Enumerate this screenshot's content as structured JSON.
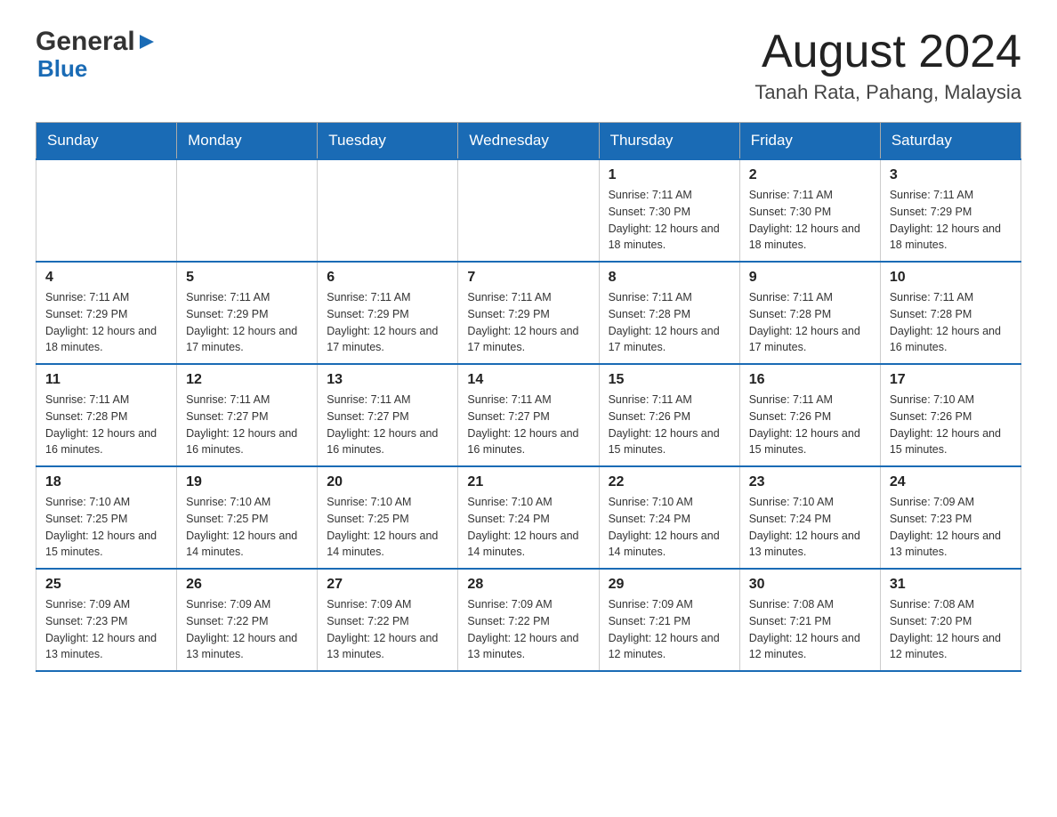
{
  "logo": {
    "general": "General",
    "blue": "Blue"
  },
  "header": {
    "title": "August 2024",
    "subtitle": "Tanah Rata, Pahang, Malaysia"
  },
  "weekdays": [
    "Sunday",
    "Monday",
    "Tuesday",
    "Wednesday",
    "Thursday",
    "Friday",
    "Saturday"
  ],
  "weeks": [
    [
      {
        "day": "",
        "info": ""
      },
      {
        "day": "",
        "info": ""
      },
      {
        "day": "",
        "info": ""
      },
      {
        "day": "",
        "info": ""
      },
      {
        "day": "1",
        "sunrise": "Sunrise: 7:11 AM",
        "sunset": "Sunset: 7:30 PM",
        "daylight": "Daylight: 12 hours and 18 minutes."
      },
      {
        "day": "2",
        "sunrise": "Sunrise: 7:11 AM",
        "sunset": "Sunset: 7:30 PM",
        "daylight": "Daylight: 12 hours and 18 minutes."
      },
      {
        "day": "3",
        "sunrise": "Sunrise: 7:11 AM",
        "sunset": "Sunset: 7:29 PM",
        "daylight": "Daylight: 12 hours and 18 minutes."
      }
    ],
    [
      {
        "day": "4",
        "sunrise": "Sunrise: 7:11 AM",
        "sunset": "Sunset: 7:29 PM",
        "daylight": "Daylight: 12 hours and 18 minutes."
      },
      {
        "day": "5",
        "sunrise": "Sunrise: 7:11 AM",
        "sunset": "Sunset: 7:29 PM",
        "daylight": "Daylight: 12 hours and 17 minutes."
      },
      {
        "day": "6",
        "sunrise": "Sunrise: 7:11 AM",
        "sunset": "Sunset: 7:29 PM",
        "daylight": "Daylight: 12 hours and 17 minutes."
      },
      {
        "day": "7",
        "sunrise": "Sunrise: 7:11 AM",
        "sunset": "Sunset: 7:29 PM",
        "daylight": "Daylight: 12 hours and 17 minutes."
      },
      {
        "day": "8",
        "sunrise": "Sunrise: 7:11 AM",
        "sunset": "Sunset: 7:28 PM",
        "daylight": "Daylight: 12 hours and 17 minutes."
      },
      {
        "day": "9",
        "sunrise": "Sunrise: 7:11 AM",
        "sunset": "Sunset: 7:28 PM",
        "daylight": "Daylight: 12 hours and 17 minutes."
      },
      {
        "day": "10",
        "sunrise": "Sunrise: 7:11 AM",
        "sunset": "Sunset: 7:28 PM",
        "daylight": "Daylight: 12 hours and 16 minutes."
      }
    ],
    [
      {
        "day": "11",
        "sunrise": "Sunrise: 7:11 AM",
        "sunset": "Sunset: 7:28 PM",
        "daylight": "Daylight: 12 hours and 16 minutes."
      },
      {
        "day": "12",
        "sunrise": "Sunrise: 7:11 AM",
        "sunset": "Sunset: 7:27 PM",
        "daylight": "Daylight: 12 hours and 16 minutes."
      },
      {
        "day": "13",
        "sunrise": "Sunrise: 7:11 AM",
        "sunset": "Sunset: 7:27 PM",
        "daylight": "Daylight: 12 hours and 16 minutes."
      },
      {
        "day": "14",
        "sunrise": "Sunrise: 7:11 AM",
        "sunset": "Sunset: 7:27 PM",
        "daylight": "Daylight: 12 hours and 16 minutes."
      },
      {
        "day": "15",
        "sunrise": "Sunrise: 7:11 AM",
        "sunset": "Sunset: 7:26 PM",
        "daylight": "Daylight: 12 hours and 15 minutes."
      },
      {
        "day": "16",
        "sunrise": "Sunrise: 7:11 AM",
        "sunset": "Sunset: 7:26 PM",
        "daylight": "Daylight: 12 hours and 15 minutes."
      },
      {
        "day": "17",
        "sunrise": "Sunrise: 7:10 AM",
        "sunset": "Sunset: 7:26 PM",
        "daylight": "Daylight: 12 hours and 15 minutes."
      }
    ],
    [
      {
        "day": "18",
        "sunrise": "Sunrise: 7:10 AM",
        "sunset": "Sunset: 7:25 PM",
        "daylight": "Daylight: 12 hours and 15 minutes."
      },
      {
        "day": "19",
        "sunrise": "Sunrise: 7:10 AM",
        "sunset": "Sunset: 7:25 PM",
        "daylight": "Daylight: 12 hours and 14 minutes."
      },
      {
        "day": "20",
        "sunrise": "Sunrise: 7:10 AM",
        "sunset": "Sunset: 7:25 PM",
        "daylight": "Daylight: 12 hours and 14 minutes."
      },
      {
        "day": "21",
        "sunrise": "Sunrise: 7:10 AM",
        "sunset": "Sunset: 7:24 PM",
        "daylight": "Daylight: 12 hours and 14 minutes."
      },
      {
        "day": "22",
        "sunrise": "Sunrise: 7:10 AM",
        "sunset": "Sunset: 7:24 PM",
        "daylight": "Daylight: 12 hours and 14 minutes."
      },
      {
        "day": "23",
        "sunrise": "Sunrise: 7:10 AM",
        "sunset": "Sunset: 7:24 PM",
        "daylight": "Daylight: 12 hours and 13 minutes."
      },
      {
        "day": "24",
        "sunrise": "Sunrise: 7:09 AM",
        "sunset": "Sunset: 7:23 PM",
        "daylight": "Daylight: 12 hours and 13 minutes."
      }
    ],
    [
      {
        "day": "25",
        "sunrise": "Sunrise: 7:09 AM",
        "sunset": "Sunset: 7:23 PM",
        "daylight": "Daylight: 12 hours and 13 minutes."
      },
      {
        "day": "26",
        "sunrise": "Sunrise: 7:09 AM",
        "sunset": "Sunset: 7:22 PM",
        "daylight": "Daylight: 12 hours and 13 minutes."
      },
      {
        "day": "27",
        "sunrise": "Sunrise: 7:09 AM",
        "sunset": "Sunset: 7:22 PM",
        "daylight": "Daylight: 12 hours and 13 minutes."
      },
      {
        "day": "28",
        "sunrise": "Sunrise: 7:09 AM",
        "sunset": "Sunset: 7:22 PM",
        "daylight": "Daylight: 12 hours and 13 minutes."
      },
      {
        "day": "29",
        "sunrise": "Sunrise: 7:09 AM",
        "sunset": "Sunset: 7:21 PM",
        "daylight": "Daylight: 12 hours and 12 minutes."
      },
      {
        "day": "30",
        "sunrise": "Sunrise: 7:08 AM",
        "sunset": "Sunset: 7:21 PM",
        "daylight": "Daylight: 12 hours and 12 minutes."
      },
      {
        "day": "31",
        "sunrise": "Sunrise: 7:08 AM",
        "sunset": "Sunset: 7:20 PM",
        "daylight": "Daylight: 12 hours and 12 minutes."
      }
    ]
  ]
}
